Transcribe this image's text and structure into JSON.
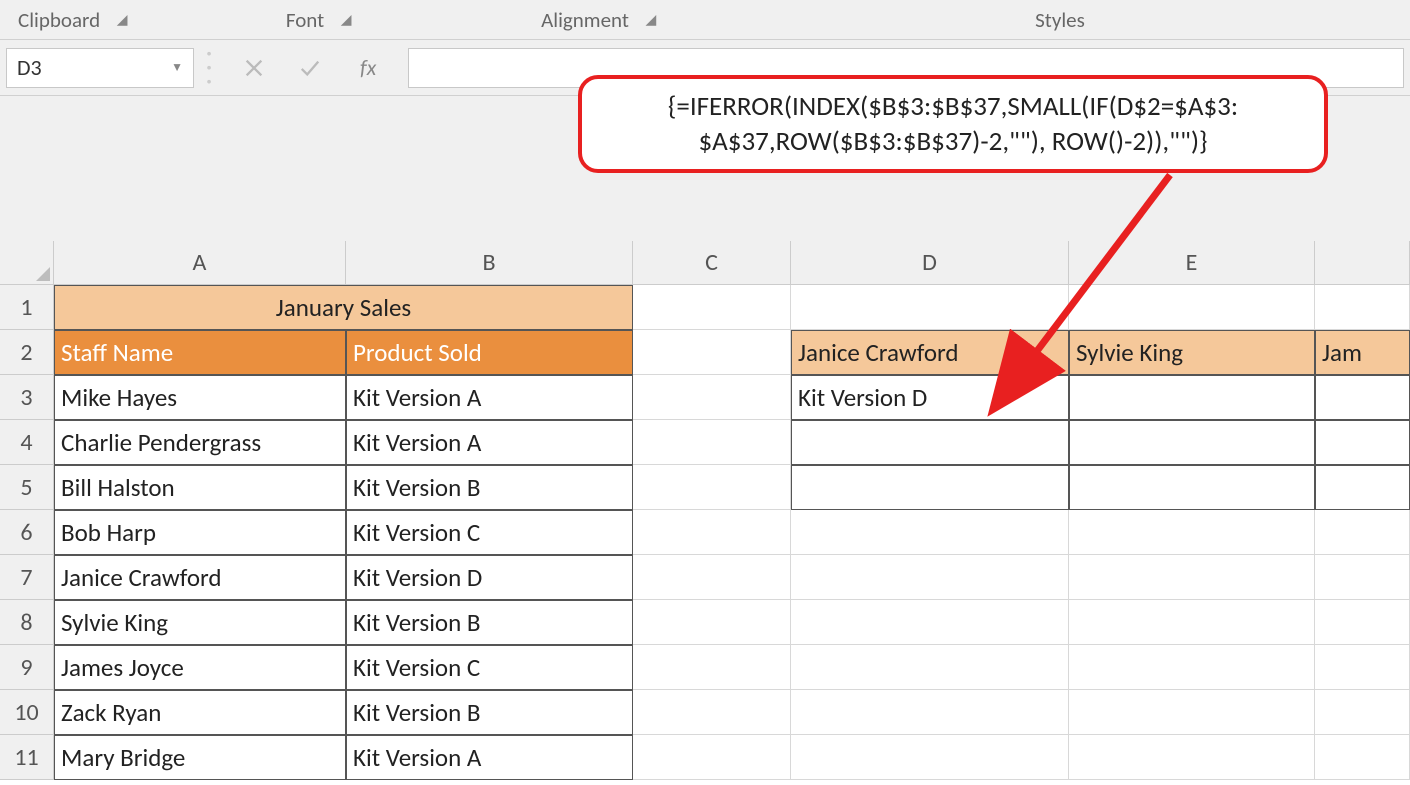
{
  "ribbon": {
    "clipboard": "Clipboard",
    "font": "Font",
    "alignment": "Alignment",
    "styles": "Styles"
  },
  "name_box": "D3",
  "fx_label": "fx",
  "formula_callout": {
    "line1": "{=IFERROR(INDEX($B$3:$B$37,SMALL(IF(D$2=$A$3:",
    "line2": "$A$37,ROW($B$3:$B$37)-2,\"\"), ROW()-2)),\"\")}"
  },
  "columns": [
    "A",
    "B",
    "C",
    "D",
    "E"
  ],
  "rows": [
    "1",
    "2",
    "3",
    "4",
    "5",
    "6",
    "7",
    "8",
    "9",
    "10",
    "11"
  ],
  "a1_title": "January Sales",
  "a2": "Staff Name",
  "b2": "Product Sold",
  "table": [
    {
      "a": "Mike Hayes",
      "b": "Kit Version A"
    },
    {
      "a": "Charlie Pendergrass",
      "b": "Kit Version A"
    },
    {
      "a": "Bill Halston",
      "b": "Kit Version B"
    },
    {
      "a": "Bob Harp",
      "b": "Kit Version C"
    },
    {
      "a": "Janice Crawford",
      "b": "Kit Version D"
    },
    {
      "a": "Sylvie King",
      "b": "Kit Version B"
    },
    {
      "a": "James Joyce",
      "b": "Kit Version C"
    },
    {
      "a": "Zack Ryan",
      "b": "Kit Version B"
    },
    {
      "a": "Mary Bridge",
      "b": "Kit Version A"
    }
  ],
  "d2": "Janice Crawford",
  "e2": "Sylvie King",
  "f2": "Jam",
  "d3": "Kit Version D"
}
